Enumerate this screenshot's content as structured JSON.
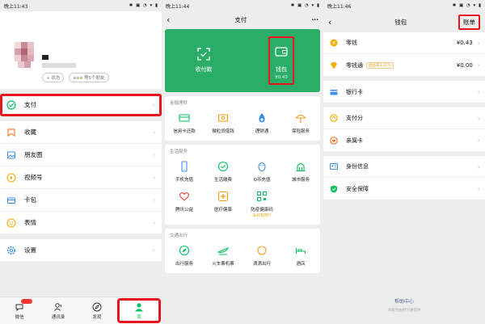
{
  "screen1": {
    "status_time": "晚上11:43",
    "status_icons": "✱ ▣ ◔ ▾ ▮",
    "status_chip": "+ 状态",
    "friends_chip": "等5个朋友",
    "menu": [
      {
        "label": "支付",
        "icon": "pay-icon"
      },
      {
        "label": "收藏",
        "icon": "favorites-icon"
      },
      {
        "label": "朋友圈",
        "icon": "moments-icon"
      },
      {
        "label": "视频号",
        "icon": "channels-icon"
      },
      {
        "label": "卡包",
        "icon": "cards-icon"
      },
      {
        "label": "表情",
        "icon": "stickers-icon"
      },
      {
        "label": "设置",
        "icon": "settings-icon"
      }
    ],
    "tabs": [
      "微信",
      "通讯录",
      "发现",
      "我"
    ]
  },
  "screen2": {
    "status_time": "晚上11:44",
    "status_icons": "✱ ▣ ◔ ▾ ▮",
    "title": "支付",
    "more": "···",
    "receive_label": "收付款",
    "wallet_label": "钱包",
    "wallet_amount": "¥0.43",
    "finance": {
      "title": "金融理财",
      "items": [
        "信用卡还款",
        "微粒贷借钱",
        "理财通",
        "保险服务"
      ]
    },
    "life": {
      "title": "生活服务",
      "items": [
        "手机充值",
        "生活缴费",
        "Q币充值",
        "城市服务",
        "腾讯公益",
        "医疗健康",
        "防疫健康码"
      ],
      "promo": "3k好友用户"
    },
    "travel": {
      "title": "交通出行",
      "items": [
        "出行服务",
        "火车票机票",
        "滴滴出行",
        "酒店"
      ]
    }
  },
  "screen3": {
    "status_time": "晚上11:46",
    "status_icons": "✱ ▣ ◔ ▾ ▮",
    "title": "钱包",
    "bill": "账单",
    "rows1": [
      {
        "label": "零钱",
        "value": "¥0.43",
        "icon": "change-icon"
      },
      {
        "label": "零钱通",
        "value": "¥0.00",
        "tag": "收益率2.35%",
        "icon": "diamond-icon"
      }
    ],
    "rows2": [
      {
        "label": "银行卡",
        "icon": "bank-card-icon"
      }
    ],
    "rows3": [
      {
        "label": "支付分",
        "icon": "pay-score-icon"
      },
      {
        "label": "亲属卡",
        "icon": "family-card-icon"
      }
    ],
    "rows4": [
      {
        "label": "身份信息",
        "icon": "id-icon"
      },
      {
        "label": "安全保障",
        "icon": "shield-icon"
      }
    ],
    "help": "帮助中心",
    "help_sub": "本服务由财付通提供"
  },
  "colors": {
    "wechat_green": "#07c160",
    "card_green": "#2aae67",
    "highlight_red": "#e8141f"
  }
}
